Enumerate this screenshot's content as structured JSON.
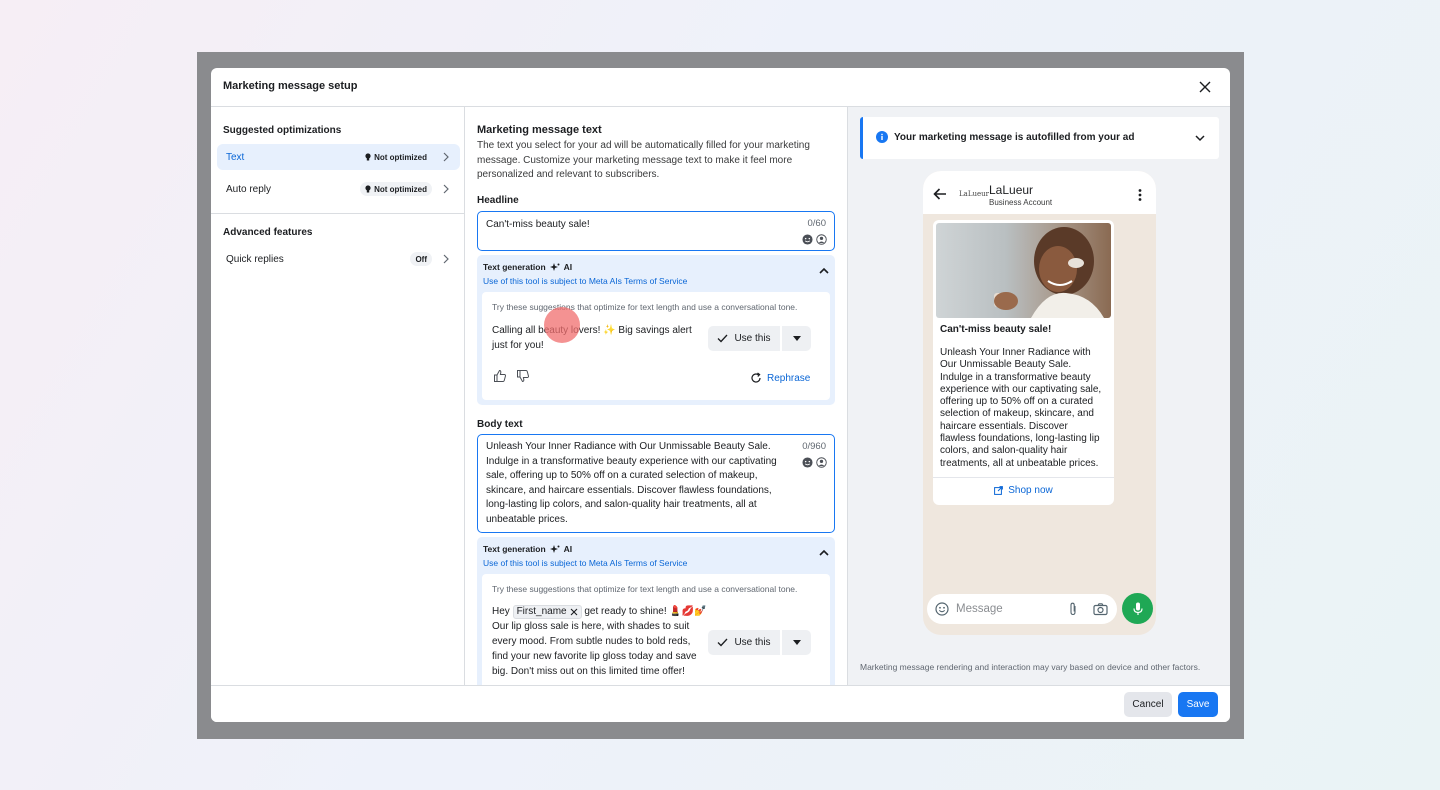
{
  "modal": {
    "title": "Marketing message setup"
  },
  "left": {
    "suggested_title": "Suggested optimizations",
    "items": [
      {
        "label": "Text",
        "badge": "Not optimized"
      },
      {
        "label": "Auto reply",
        "badge": "Not optimized"
      }
    ],
    "advanced_title": "Advanced features",
    "advanced_items": [
      {
        "label": "Quick replies",
        "badge": "Off"
      }
    ]
  },
  "middle": {
    "title": "Marketing message text",
    "description": "The text you select for your ad will be automatically filled for your marketing message. Customize your marketing message text to make it feel more personalized and relevant to subscribers.",
    "headline_label": "Headline",
    "headline_value": "Can't-miss beauty sale!",
    "headline_counter": "0/60",
    "gen_title": "Text generation",
    "gen_ai": "AI",
    "gen_link": "Use of this tool is subject to Meta AIs Terms of Service",
    "sugg_hint": "Try these suggestions that optimize for text length and use a conversational tone.",
    "headline_suggestion_1": "Calling all beauty lovers! ✨ Big savings alert",
    "headline_suggestion_2": "just for you!",
    "use_label": "Use this",
    "rephrase_label": "Rephrase",
    "body_label": "Body text",
    "body_counter": "0/960",
    "body_lines": [
      "Unleash Your Inner Radiance with Our Unmissable Beauty Sale.",
      "Indulge in a transformative beauty experience with our captivating",
      "sale, offering up to 50% off on a curated selection of makeup,",
      "skincare, and haircare essentials. Discover flawless foundations,",
      "long-lasting lip colors, and salon-quality hair treatments, all at",
      "unbeatable prices."
    ],
    "body_sugg_hey": "Hey",
    "body_sugg_pill": "First_name",
    "body_sugg_rest": "get ready to shine! 💄💋💅",
    "body_sugg_lines": [
      "Our lip gloss sale is here, with shades to suit",
      "every mood. From subtle nudes to bold reds,",
      "find your new favorite lip gloss today and save",
      "big. Don't miss out on this limited time offer!"
    ]
  },
  "right": {
    "info": "Your marketing message is autofilled from your ad",
    "brand_logo": "LaLueur",
    "contact_name": "LaLueur",
    "contact_sub": "Business Account",
    "headline": "Can't-miss beauty sale!",
    "body_lines": [
      "Unleash Your Inner Radiance with",
      "Our Unmissable Beauty Sale.",
      "Indulge in a transformative beauty",
      "experience with our captivating sale,",
      "offering up to 50% off on a curated",
      "selection of makeup, skincare, and",
      "haircare essentials. Discover",
      "flawless foundations, long-lasting lip",
      "colors, and salon-quality hair",
      "treatments, all at unbeatable prices."
    ],
    "shop_now": "Shop now",
    "message_placeholder": "Message",
    "disclaimer": "Marketing message rendering and interaction may vary based on device and other factors."
  },
  "footer": {
    "cancel": "Cancel",
    "save": "Save"
  },
  "colors": {
    "accent": "#1877f2",
    "link": "#0a66d6",
    "mic": "#1fa855"
  }
}
